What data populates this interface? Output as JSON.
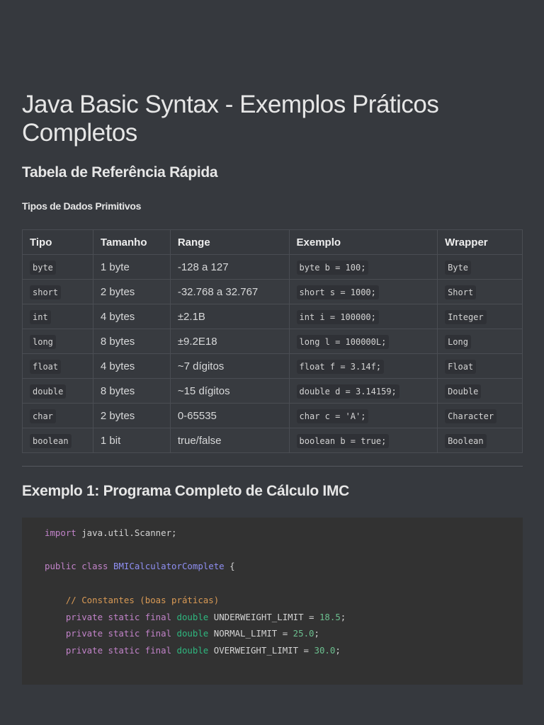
{
  "title": "Java Basic Syntax - Exemplos Práticos Completos",
  "section1": "Tabela de Referência Rápida",
  "subsection1": "Tipos de Dados Primitivos",
  "table": {
    "headers": [
      "Tipo",
      "Tamanho",
      "Range",
      "Exemplo",
      "Wrapper"
    ],
    "rows": [
      [
        "byte",
        "1 byte",
        "-128 a 127",
        "byte b = 100;",
        "Byte"
      ],
      [
        "short",
        "2 bytes",
        "-32.768 a 32.767",
        "short s = 1000;",
        "Short"
      ],
      [
        "int",
        "4 bytes",
        "±2.1B",
        "int i = 100000;",
        "Integer"
      ],
      [
        "long",
        "8 bytes",
        "±9.2E18",
        "long l = 100000L;",
        "Long"
      ],
      [
        "float",
        "4 bytes",
        "~7 dígitos",
        "float f = 3.14f;",
        "Float"
      ],
      [
        "double",
        "8 bytes",
        "~15 dígitos",
        "double d = 3.14159;",
        "Double"
      ],
      [
        "char",
        "2 bytes",
        "0-65535",
        "char c = 'A';",
        "Character"
      ],
      [
        "boolean",
        "1 bit",
        "true/false",
        "boolean b = true;",
        "Boolean"
      ]
    ]
  },
  "section2": "Exemplo 1: Programa Completo de Cálculo IMC",
  "code": {
    "l1": [
      "import",
      " java.util.Scanner;"
    ],
    "l2": [
      "public class ",
      "BMICalculatorComplete",
      " {"
    ],
    "comment": "    // Constantes (boas práticas)",
    "consts": [
      [
        "UNDERWEIGHT_LIMIT",
        "18.5"
      ],
      [
        "NORMAL_LIMIT",
        "25.0"
      ],
      [
        "OVERWEIGHT_LIMIT",
        "30.0"
      ]
    ],
    "mod": "    private static final ",
    "type": "double"
  }
}
